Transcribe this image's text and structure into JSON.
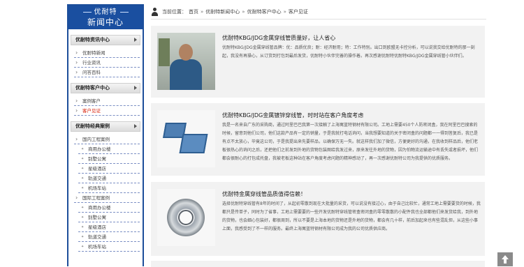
{
  "sidebar": {
    "brand": "优耐特",
    "title": "新闻中心",
    "sections": [
      {
        "label": "优耐特资讯中心",
        "items": [
          {
            "label": "优耐特新闻",
            "active": false,
            "sub": false
          },
          {
            "label": "行业资讯",
            "active": false,
            "sub": false
          },
          {
            "label": "问答百科",
            "active": false,
            "sub": false
          }
        ]
      },
      {
        "label": "优耐特客户中心",
        "items": [
          {
            "label": "案例客户",
            "active": false,
            "sub": false
          },
          {
            "label": "客户见证",
            "active": true,
            "sub": false
          }
        ]
      },
      {
        "label": "优耐特经典案例",
        "items": [
          {
            "label": "国内工程案例",
            "active": false,
            "sub": false
          },
          {
            "label": "商用办公楼",
            "active": false,
            "sub": true
          },
          {
            "label": "别墅公寓",
            "active": false,
            "sub": true
          },
          {
            "label": "星级酒店",
            "active": false,
            "sub": true
          },
          {
            "label": "轨道交通",
            "active": false,
            "sub": true
          },
          {
            "label": "机场车站",
            "active": false,
            "sub": true
          },
          {
            "label": "国际工程案例",
            "active": false,
            "sub": false
          },
          {
            "label": "商用办公楼",
            "active": false,
            "sub": true
          },
          {
            "label": "别墅公寓",
            "active": false,
            "sub": true
          },
          {
            "label": "星级酒店",
            "active": false,
            "sub": true
          },
          {
            "label": "轨道交通",
            "active": false,
            "sub": true
          },
          {
            "label": "机场车站",
            "active": false,
            "sub": true
          }
        ]
      }
    ]
  },
  "breadcrumb": {
    "prefix": "当前位置：",
    "items": [
      "首页",
      "优耐特新闻中心",
      "优耐特客户中心",
      "客户见证"
    ],
    "separator": "»"
  },
  "articles": [
    {
      "title": "优耐特KBG/JDG金属穿线管质量好，让人省心",
      "body": "优耐特KBG/JDG金属穿线管品牌：优：品质优良；耐：经济耐用；特：工作特别。出口到欧盟无卡控分析，可以说我交给优耐特的那一刻起，我没有再操心，从订货到打包到最后发货，优耐特小伙伴完善的操作着。再次感谢优耐特优耐特KBG/JDG金属穿线管小伙伴们。"
    },
    {
      "title": "优耐特KBG/JDG金属镀锌穿线管，时时站在客户角度考虑",
      "body": "我是一名来自广东的采购商，通过阿里巴巴我第一次接触了上海寓蓝特钢材有限公司。工地上需要450个人防密闭盒，我在阿里巴巴搜索的时候，留意到他们公司，他们这款产品有一定的销量，于是我就打电话询问，当我想要知道的关于密闭盒的问题都一一得到答复后，我已是有点不太放心，毕竟这公司，于是我提出来先要样品，以确保万无一失。就这样我们加了微信，方便更好的沟通，在我收到样品后，他们老板很热心的询问之后，还把他们之前发到外地的货物包装图给我发过来，原来发往外地的货物，因为怕物流运输途中有丢失或者损坏，他们都会很耐心的打包成托盘，我被老板这种站在客户角度考虑问题的精神感动了，再一次感谢优耐特公司为我提供的优质服务。"
    },
    {
      "title": "优耐特金属穿线管品质值得信赖！",
      "body": "选择优耐特穿线管有8年的时间了，从起初零散到现在大批量的采货，可以说没有接过心，由于自己比较忙，通常工地上需要要货的时候，我都只是传单子，同时为了省事，工地上需要要的一些开发优耐特穿线管密盒密闭盒的零零散散的小配件我也全部都他们来发货给我，到外地的货物，也会细心包装好，都很周到，所以不要是上海本地的货物还是外地的货物，都会有几十样，前后加起来也有些混乱但，从这些小事上面，我感受到了不一样的服务。最终上海寓蓝特钢材有限公司成为我的公司优质供应商。"
    }
  ],
  "back_to_top": "up-arrow-icon"
}
